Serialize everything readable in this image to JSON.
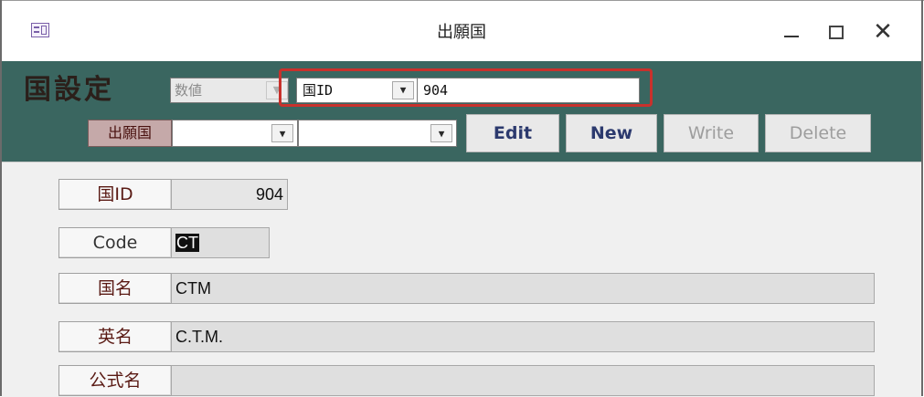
{
  "window": {
    "title": "出願国",
    "controls": {
      "minimize": "–",
      "maximize": "□",
      "close": "×"
    }
  },
  "header": {
    "form_title": "国設定",
    "filter_type": "数値",
    "field_selector": "国ID",
    "field_value": "904",
    "country_label": "出願国",
    "country_combo1": "",
    "country_combo2": ""
  },
  "actions": {
    "edit": "Edit",
    "new": "New",
    "write": "Write",
    "delete": "Delete"
  },
  "record": {
    "country_id_label": "国ID",
    "country_id": "904",
    "code_label": "Code",
    "code": "CT",
    "name_label": "国名",
    "name": "CTM",
    "english_label": "英名",
    "english": "C.T.M.",
    "official_label": "公式名",
    "official": ""
  },
  "colors": {
    "header_bg": "#3a6660",
    "highlight_frame": "#c8312c",
    "label_text": "#5a1a14"
  },
  "icons": {
    "app": "form-icon",
    "dropdown": "chevron-down-icon"
  }
}
